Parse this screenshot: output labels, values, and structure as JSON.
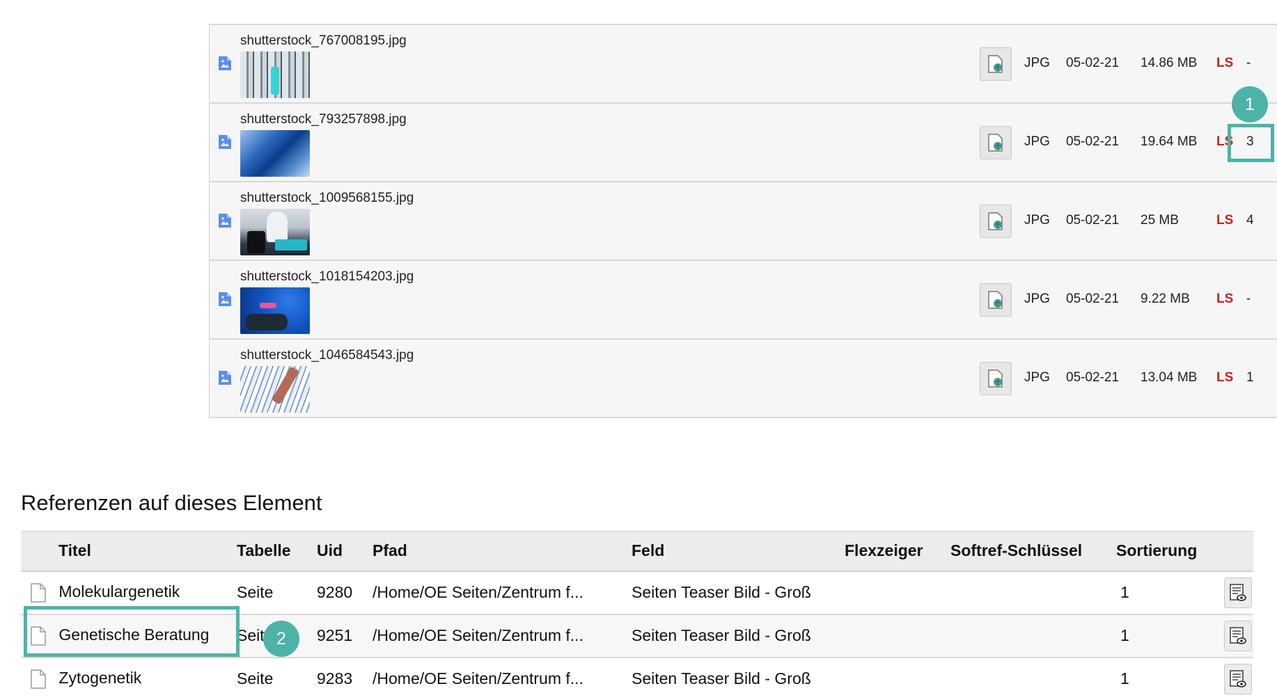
{
  "files": [
    {
      "name": "shutterstock_767008195.jpg",
      "type": "JPG",
      "date": "05-02-21",
      "size": "14.86 MB",
      "ls": "LS",
      "refs": "-"
    },
    {
      "name": "shutterstock_793257898.jpg",
      "type": "JPG",
      "date": "05-02-21",
      "size": "19.64 MB",
      "ls": "LS",
      "refs": "3"
    },
    {
      "name": "shutterstock_1009568155.jpg",
      "type": "JPG",
      "date": "05-02-21",
      "size": "25 MB",
      "ls": "LS",
      "refs": "4"
    },
    {
      "name": "shutterstock_1018154203.jpg",
      "type": "JPG",
      "date": "05-02-21",
      "size": "9.22 MB",
      "ls": "LS",
      "refs": "-"
    },
    {
      "name": "shutterstock_1046584543.jpg",
      "type": "JPG",
      "date": "05-02-21",
      "size": "13.04 MB",
      "ls": "LS",
      "refs": "1"
    }
  ],
  "annotations": {
    "badge1": "1",
    "badge2": "2"
  },
  "references": {
    "heading": "Referenzen auf dieses Element",
    "columns": {
      "titel": "Titel",
      "tabelle": "Tabelle",
      "uid": "Uid",
      "pfad": "Pfad",
      "feld": "Feld",
      "flexzeiger": "Flexzeiger",
      "softref": "Softref-Schlüssel",
      "sortierung": "Sortierung"
    },
    "rows": [
      {
        "titel": "Molekulargenetik",
        "tabelle": "Seite",
        "uid": "9280",
        "pfad": "/Home/OE Seiten/Zentrum f...",
        "feld": "Seiten Teaser Bild - Groß",
        "flexzeiger": "",
        "softref": "",
        "sortierung": "1"
      },
      {
        "titel": "Genetische Beratung",
        "tabelle": "Seite",
        "uid": "9251",
        "pfad": "/Home/OE Seiten/Zentrum f...",
        "feld": "Seiten Teaser Bild - Groß",
        "flexzeiger": "",
        "softref": "",
        "sortierung": "1"
      },
      {
        "titel": "Zytogenetik",
        "tabelle": "Seite",
        "uid": "9283",
        "pfad": "/Home/OE Seiten/Zentrum f...",
        "feld": "Seiten Teaser Bild - Groß",
        "flexzeiger": "",
        "softref": "",
        "sortierung": "1"
      }
    ]
  },
  "colors": {
    "accent": "#4db3a8",
    "ls": "#cc1f1f",
    "file_icon": "#5b8def"
  },
  "icons": {
    "file_type": "image-file-icon",
    "info": "file-info-icon",
    "page": "page-document-icon",
    "action": "record-view-icon"
  }
}
